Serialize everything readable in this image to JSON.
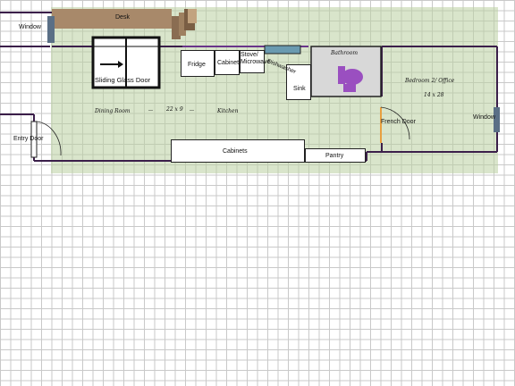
{
  "labels": {
    "window_left": "Window",
    "desk": "Desk",
    "sliding_door": "Sliding Glass Door",
    "fridge": "Fridge",
    "cabinet": "Cabinet",
    "stove": "Stove/ Microwave",
    "dishwasher": "Dishwasher",
    "sink": "Sink",
    "bathroom": "Bathroom",
    "bedroom": "Bedroom 2/ Office",
    "bedroom_dim": "14 x 28",
    "dining": "Dining Room",
    "dining_dim": "22 x 9",
    "kitchen": "Kitchen",
    "french_door": "French Door",
    "window_right": "Window",
    "entry_door": "Entry Door",
    "cabinets": "Cabinets",
    "pantry": "Pantry"
  },
  "colors": {
    "grid": "#c9c9c9",
    "wall": "#3b1f4a",
    "patio_green": "#b9cfa0",
    "desk_wood": "#a8896a",
    "window_blue": "#5a6f86",
    "toilet_purple": "#9a4fc0",
    "french_door_orange": "#e8a040"
  }
}
